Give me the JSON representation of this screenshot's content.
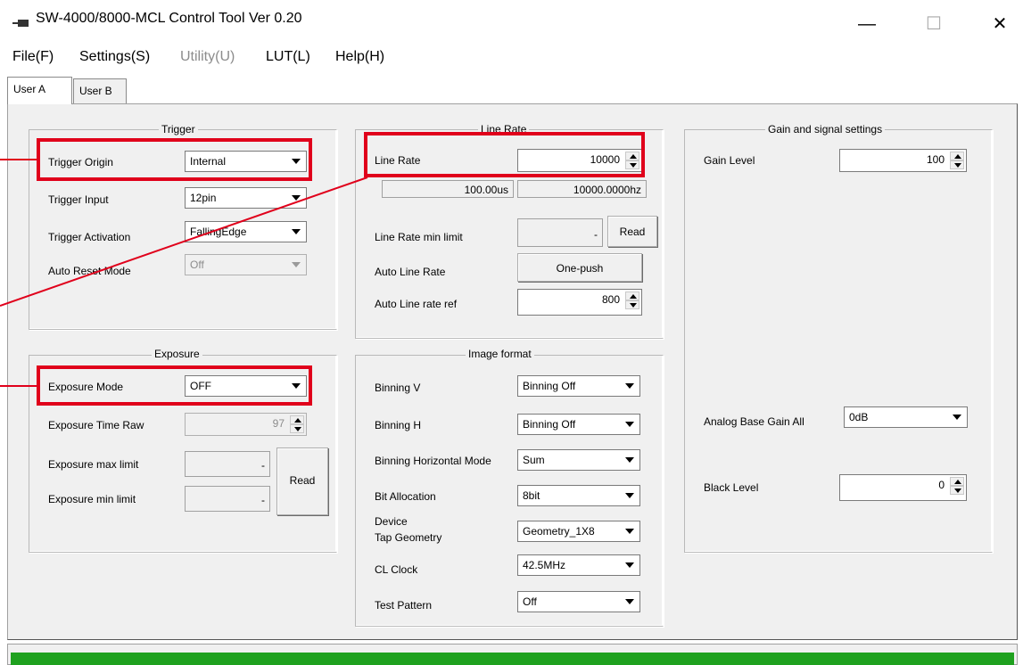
{
  "window": {
    "title": "SW-4000/8000-MCL Control Tool  Ver 0.20",
    "controls": {
      "minimize": "—",
      "maximize": "☐",
      "close": "✕"
    }
  },
  "menu": [
    "File(F)",
    "Settings(S)",
    "Utility(U)",
    "LUT(L)",
    "Help(H)"
  ],
  "tabs": [
    {
      "label": "User A",
      "active": true
    },
    {
      "label": "User B",
      "active": false
    }
  ],
  "trigger": {
    "title": "Trigger",
    "origin_label": "Trigger Origin",
    "origin_value": "Internal",
    "input_label": "Trigger Input",
    "input_value": "12pin",
    "activation_label": "Trigger Activation",
    "activation_value": "FallingEdge",
    "auto_reset_label": "Auto Reset Mode",
    "auto_reset_value": "Off"
  },
  "exposure": {
    "title": "Exposure",
    "mode_label": "Exposure Mode",
    "mode_value": "OFF",
    "time_raw_label": "Exposure Time Raw",
    "time_raw_value": "97",
    "max_label": "Exposure max limit",
    "max_value": "-",
    "min_label": "Exposure min limit",
    "min_value": "-",
    "read_label": "Read"
  },
  "line_rate": {
    "title": "Line Rate",
    "rate_label": "Line Rate",
    "rate_value": "10000",
    "period_readout": "100.00us",
    "hz_readout": "10000.0000hz",
    "min_limit_label": "Line Rate min limit",
    "min_limit_value": "-",
    "read_label": "Read",
    "auto_label": "Auto Line Rate",
    "auto_button": "One-push",
    "auto_ref_label": "Auto Line rate ref",
    "auto_ref_value": "800"
  },
  "image_format": {
    "title": "Image format",
    "binning_v_label": "Binning V",
    "binning_v_value": "Binning Off",
    "binning_h_label": "Binning H",
    "binning_h_value": "Binning Off",
    "binning_h_mode_label": "Binning Horizontal Mode",
    "binning_h_mode_value": "Sum",
    "bit_alloc_label": "Bit Allocation",
    "bit_alloc_value": "8bit",
    "tap_geo_label_1": "Device",
    "tap_geo_label_2": "Tap Geometry",
    "tap_geo_value": "Geometry_1X8",
    "cl_clock_label": "CL Clock",
    "cl_clock_value": "42.5MHz",
    "test_pattern_label": "Test Pattern",
    "test_pattern_value": "Off"
  },
  "gain": {
    "title": "Gain and signal settings",
    "level_label": "Gain Level",
    "level_value": "100",
    "analog_label": "Analog Base Gain All",
    "analog_value": "0dB",
    "black_label": "Black Level",
    "black_value": "0"
  },
  "status": {
    "progress": 1.0
  },
  "colors": {
    "highlight": "#e0001b",
    "progress": "#1fa11f",
    "panel": "#f0f0f0"
  }
}
